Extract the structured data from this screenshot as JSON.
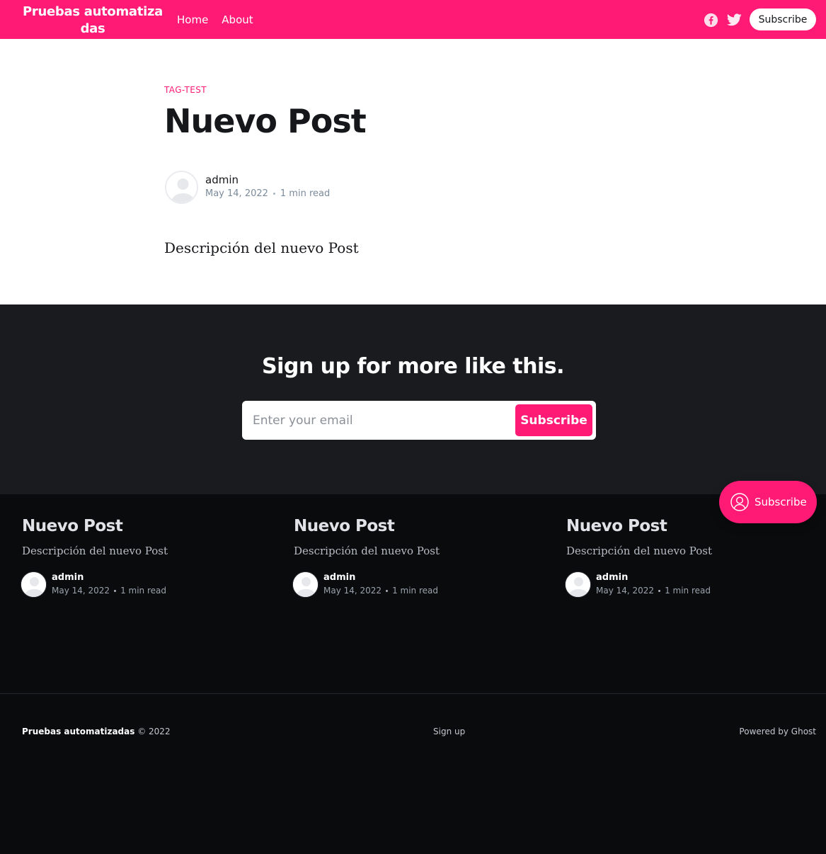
{
  "header": {
    "brand": "Pruebas automatizadas",
    "nav": [
      "Home",
      "About"
    ],
    "social": [
      "facebook-icon",
      "twitter-icon"
    ],
    "subscribe_label": "Subscribe"
  },
  "article": {
    "tag": "TAG-TEST",
    "title": "Nuevo Post",
    "author": "admin",
    "date": "May 14, 2022",
    "read_time": "1 min read",
    "body": "Descripción del nuevo Post"
  },
  "cta": {
    "title": "Sign up for more like this.",
    "email_placeholder": "Enter your email",
    "button_label": "Subscribe"
  },
  "related": [
    {
      "title": "Nuevo Post",
      "excerpt": "Descripción del nuevo Post",
      "author": "admin",
      "date": "May 14, 2022",
      "read_time": "1 min read"
    },
    {
      "title": "Nuevo Post",
      "excerpt": "Descripción del nuevo Post",
      "author": "admin",
      "date": "May 14, 2022",
      "read_time": "1 min read"
    },
    {
      "title": "Nuevo Post",
      "excerpt": "Descripción del nuevo Post",
      "author": "admin",
      "date": "May 14, 2022",
      "read_time": "1 min read"
    }
  ],
  "footer": {
    "site_name": "Pruebas automatizadas",
    "copyright": "© 2022",
    "signup": "Sign up",
    "powered": "Powered by Ghost"
  },
  "portal": {
    "label": "Subscribe"
  },
  "colors": {
    "accent": "#ff1a75",
    "cta_bg": "#191b1f",
    "footer_bg": "#0a0b0d"
  }
}
